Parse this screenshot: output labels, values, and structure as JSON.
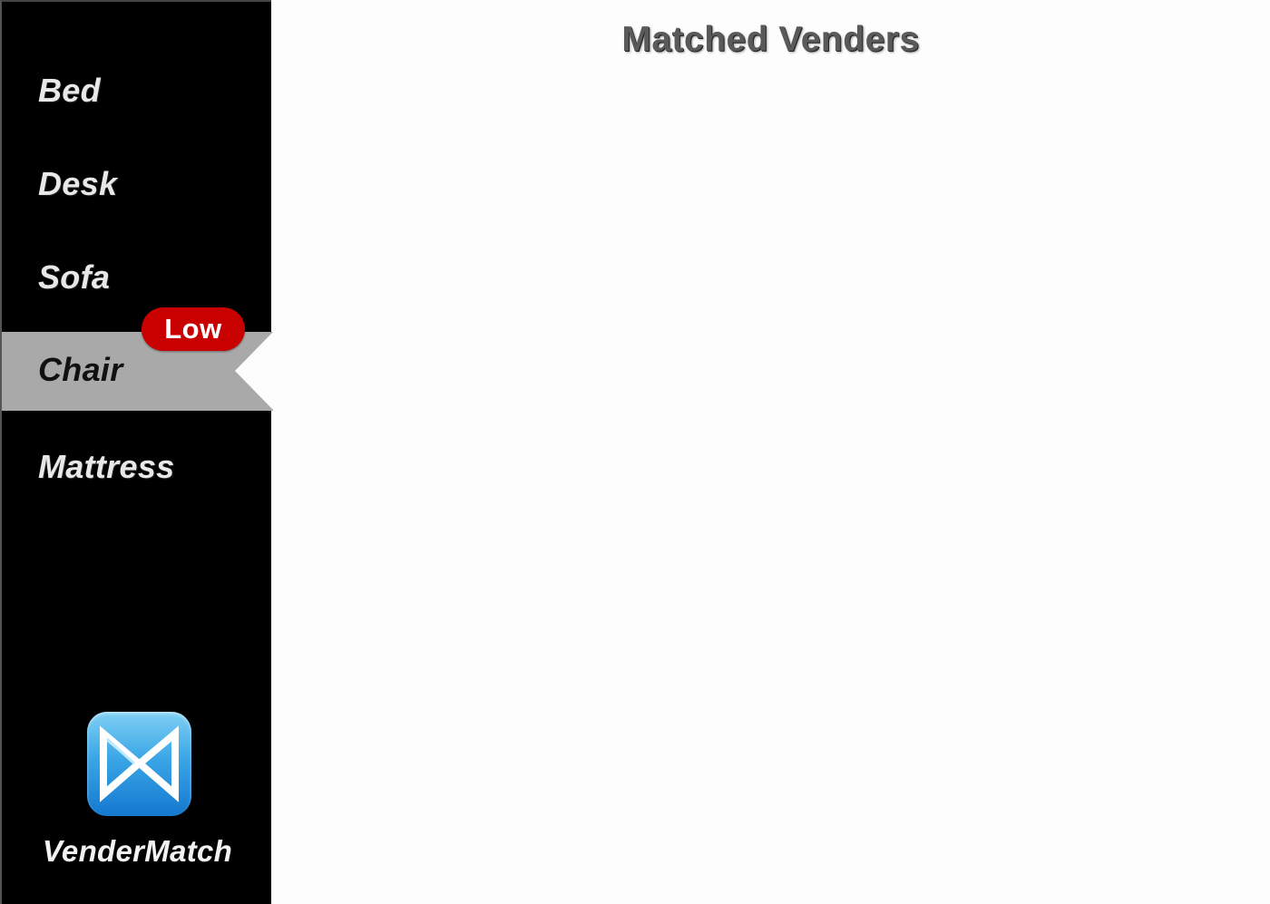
{
  "sidebar": {
    "items": [
      {
        "label": "Bed"
      },
      {
        "label": "Desk"
      },
      {
        "label": "Sofa"
      },
      {
        "label": "Chair",
        "selected": true,
        "badge": "Low"
      },
      {
        "label": "Mattress"
      }
    ]
  },
  "brand": {
    "name": "VenderMatch",
    "icon": "bowtie-x-logo-icon"
  },
  "main": {
    "title": "Matched Venders"
  },
  "colors": {
    "sidebar_bg": "#000000",
    "selected_bg": "#a9a9a9",
    "badge_bg": "#c90000",
    "logo_blue": "#2a94e0"
  }
}
